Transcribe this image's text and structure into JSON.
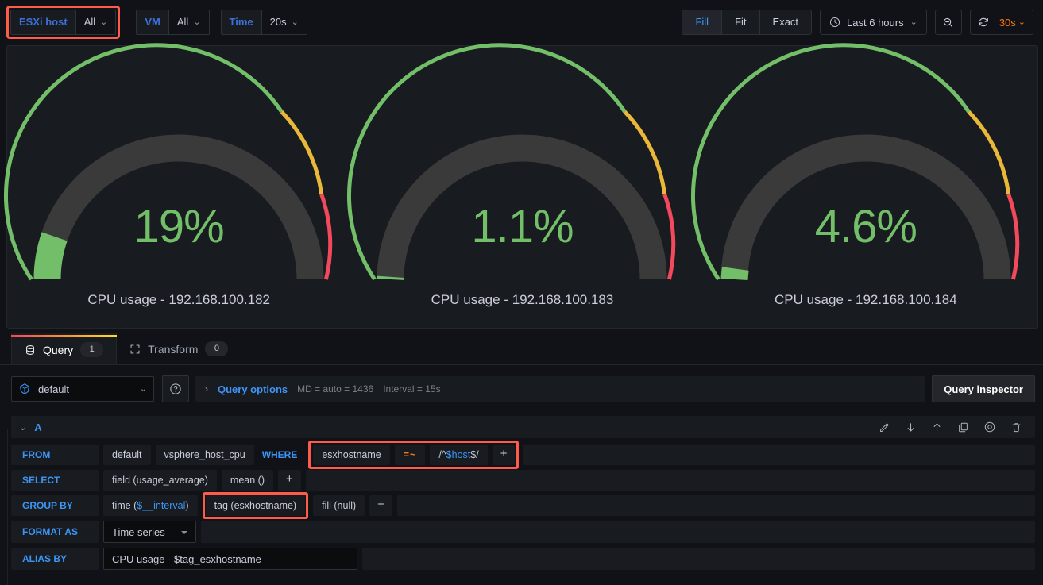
{
  "toolbar": {
    "variables": [
      {
        "label": "ESXi host",
        "value": "All",
        "highlighted": true
      },
      {
        "label": "VM",
        "value": "All",
        "highlighted": false
      },
      {
        "label": "Time",
        "value": "20s",
        "highlighted": false
      }
    ],
    "scale_buttons": [
      {
        "label": "Fill",
        "active": true
      },
      {
        "label": "Fit",
        "active": false
      },
      {
        "label": "Exact",
        "active": false
      }
    ],
    "time_range": "Last 6 hours",
    "refresh_interval": "30s",
    "accent_blue": "#3d95f5",
    "accent_orange": "#ff780a",
    "highlight_red": "#ff5b4a"
  },
  "panel": {
    "gauges": [
      {
        "value_label": "19%",
        "value": 19,
        "title": "CPU usage - 192.168.100.182"
      },
      {
        "value_label": "1.1%",
        "value": 1.1,
        "title": "CPU usage - 192.168.100.183"
      },
      {
        "value_label": "4.6%",
        "value": 4.6,
        "title": "CPU usage - 192.168.100.184"
      }
    ],
    "thresholds": [
      {
        "from": 0,
        "to": 70,
        "color": "#73bf69"
      },
      {
        "from": 70,
        "to": 90,
        "color": "#eab839"
      },
      {
        "from": 90,
        "to": 100,
        "color": "#f2495c"
      }
    ],
    "min": 0,
    "max": 100,
    "track_color": "#3a3a3a",
    "value_color": "#73bf69"
  },
  "tabs": [
    {
      "label": "Query",
      "count": "1",
      "active": true,
      "icon": "database-icon"
    },
    {
      "label": "Transform",
      "count": "0",
      "active": false,
      "icon": "expand-icon"
    }
  ],
  "query_options": {
    "datasource": "default",
    "chevron": "›",
    "link": "Query options",
    "max_data_points": "MD = auto = 1436",
    "interval": "Interval = 15s",
    "inspector_label": "Query inspector"
  },
  "query_row": {
    "id": "A",
    "actions": [
      "pencil-icon",
      "move-down-icon",
      "move-up-icon",
      "duplicate-icon",
      "hide-icon",
      "delete-icon"
    ]
  },
  "editor": {
    "from": {
      "label": "FROM",
      "policy": "default",
      "measurement": "vsphere_host_cpu",
      "where_label": "WHERE",
      "where_key": "esxhostname",
      "where_op": "=~",
      "where_value_prefix": "/^",
      "where_value_var": "$host",
      "where_value_suffix": "$/",
      "add": "+",
      "highlighted": true
    },
    "select": {
      "label": "SELECT",
      "parts": [
        "field (usage_average)",
        "mean ()"
      ],
      "add": "+"
    },
    "group_by": {
      "label": "GROUP BY",
      "time_prefix": "time (",
      "time_var": "$__interval",
      "time_suffix": ")",
      "tag": "tag (esxhostname)",
      "tag_highlighted": true,
      "fill": "fill (null)",
      "add": "+"
    },
    "format_as": {
      "label": "FORMAT AS",
      "value": "Time series"
    },
    "alias_by": {
      "label": "ALIAS BY",
      "value": "CPU usage - $tag_esxhostname"
    }
  }
}
